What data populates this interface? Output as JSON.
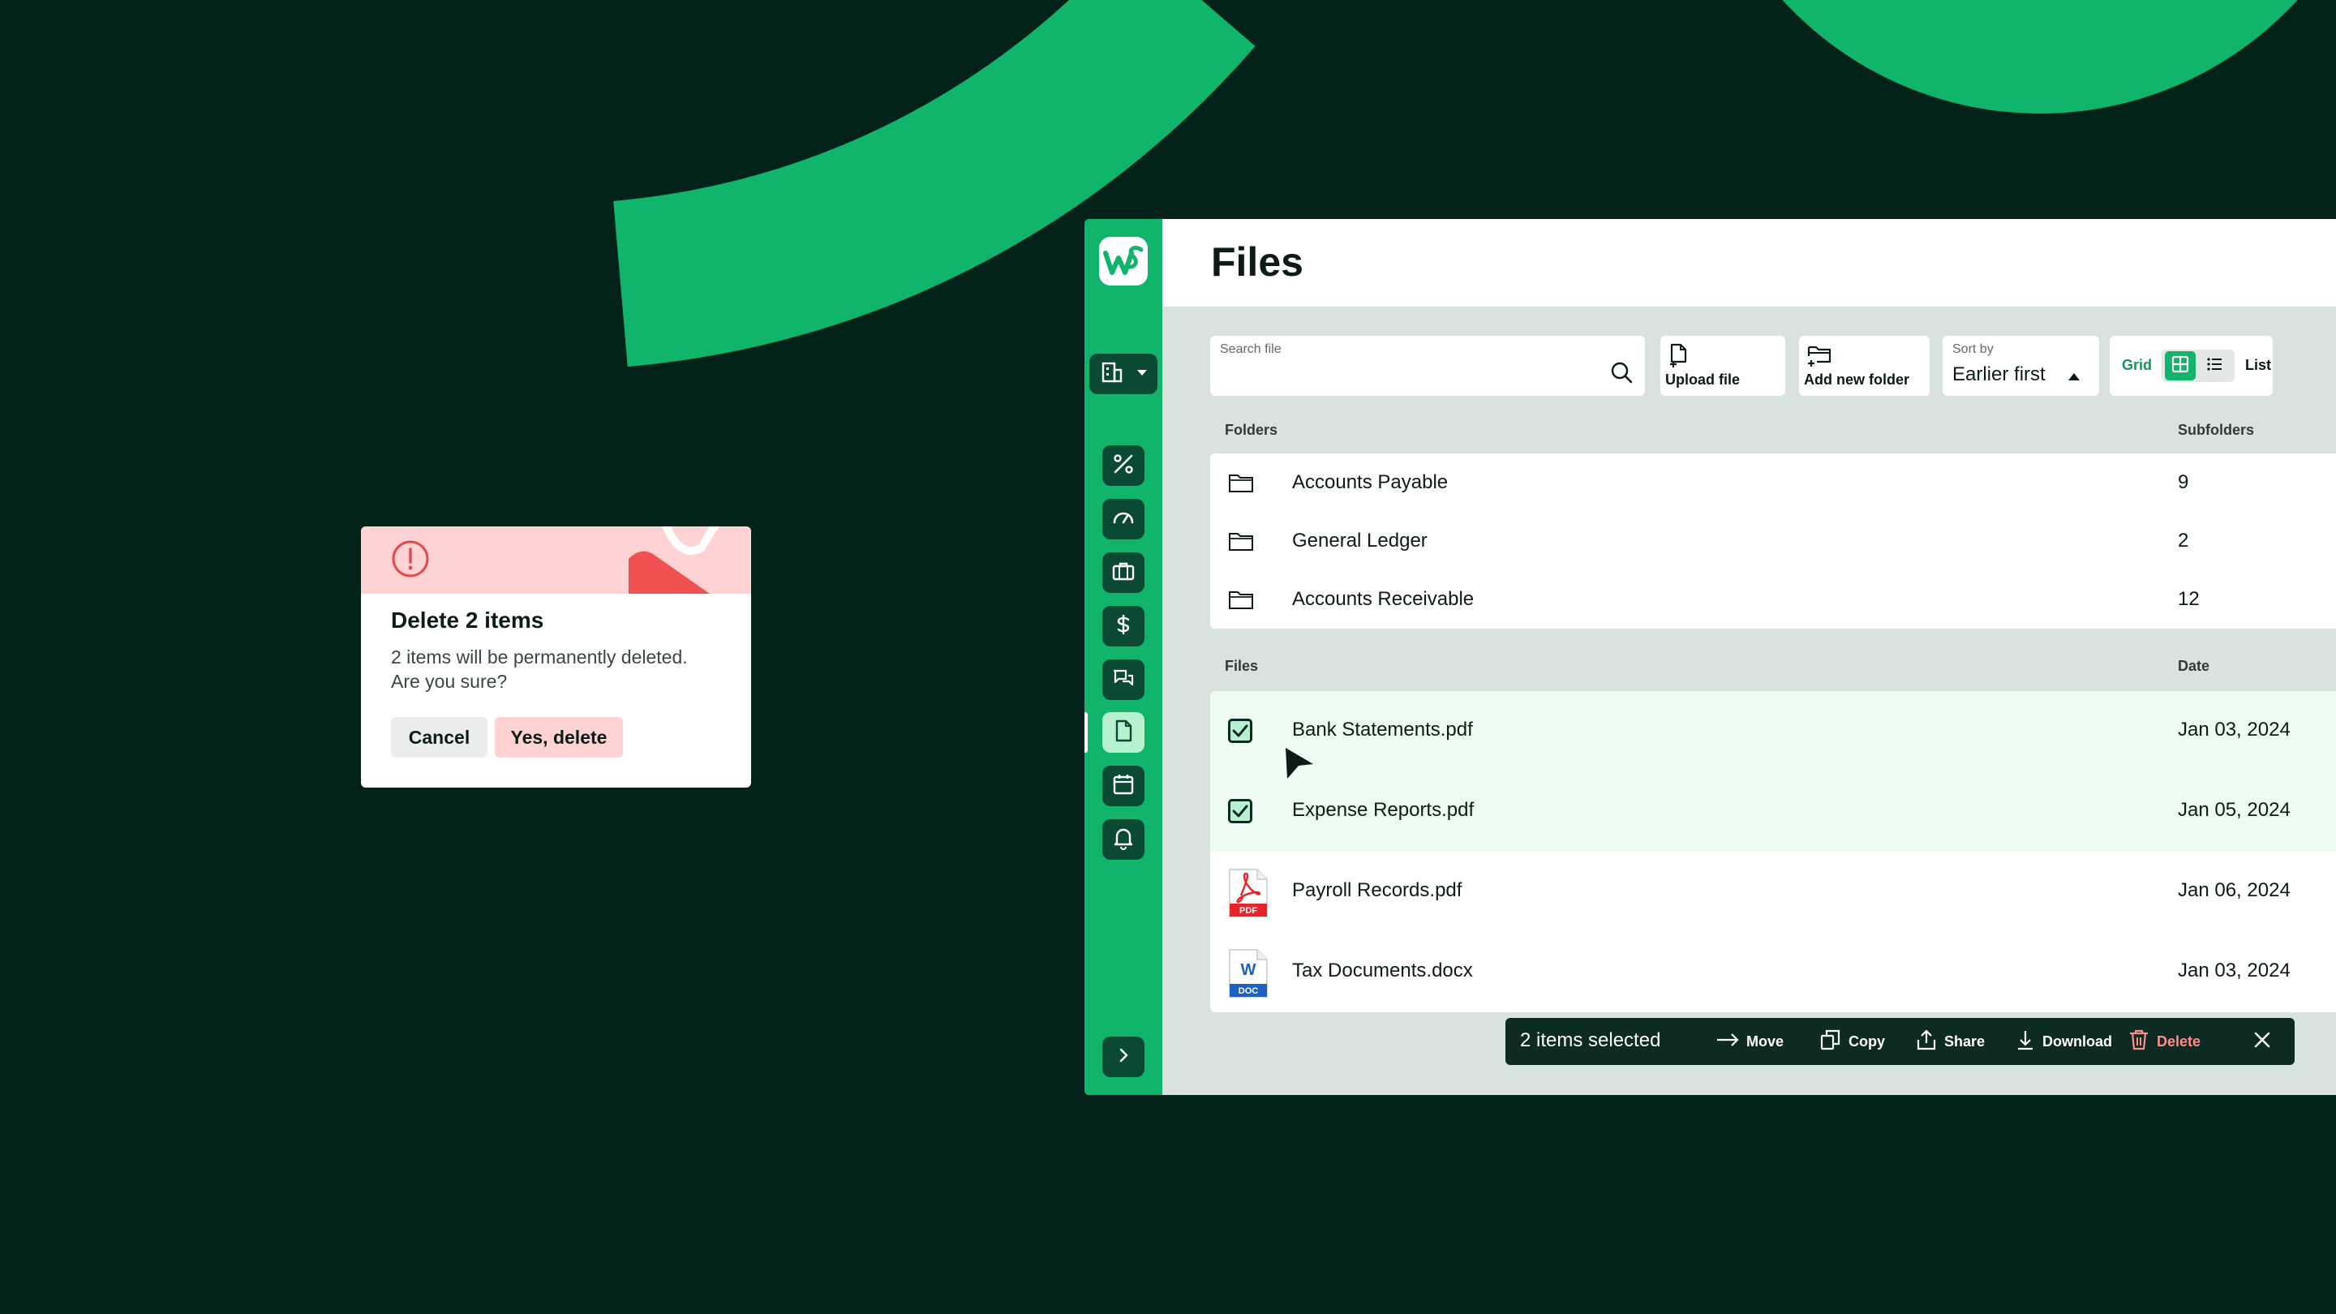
{
  "colors": {
    "brand_green": "#10b46a",
    "background": "#03221a",
    "danger": "#e5484d"
  },
  "sidebar": {
    "logo": "ws-logo",
    "org_switch_icon": "building-icon",
    "nav": [
      "percent-icon",
      "gauge-icon",
      "briefcase-icon",
      "dollar-icon",
      "chat-icon",
      "file-icon",
      "calendar-icon",
      "bell-icon"
    ],
    "active": "file-icon",
    "expand_icon": "chevron-right-icon"
  },
  "header": {
    "title": "Files"
  },
  "toolbar": {
    "search_label": "Search file",
    "upload_label": "Upload file",
    "add_folder_label": "Add new folder",
    "sort_label": "Sort by",
    "sort_value": "Earlier first",
    "view_grid_label": "Grid",
    "view_list_label": "List",
    "active_view": "grid"
  },
  "folders": {
    "header": "Folders",
    "count_header": "Subfolders",
    "items": [
      {
        "name": "Accounts Payable",
        "subfolders": "9"
      },
      {
        "name": "General Ledger",
        "subfolders": "2"
      },
      {
        "name": "Accounts Receivable",
        "subfolders": "12"
      }
    ]
  },
  "files": {
    "header": "Files",
    "date_header": "Date",
    "items": [
      {
        "name": "Bank Statements.pdf",
        "date": "Jan 03, 2024",
        "selected": true
      },
      {
        "name": "Expense Reports.pdf",
        "date": "Jan 05, 2024",
        "selected": true
      },
      {
        "name": "Payroll Records.pdf",
        "date": "Jan 06, 2024",
        "selected": false,
        "badge": "PDF"
      },
      {
        "name": "Tax Documents.docx",
        "date": "Jan 03, 2024",
        "selected": false,
        "badge": "DOC",
        "glyph": "W"
      }
    ]
  },
  "action_bar": {
    "count": "2 items selected",
    "move": "Move",
    "copy": "Copy",
    "share": "Share",
    "download": "Download",
    "delete": "Delete"
  },
  "dialog": {
    "title": "Delete 2 items",
    "message_line1": "2 items will be permanently deleted.",
    "message_line2": "Are you sure?",
    "cancel": "Cancel",
    "confirm": "Yes, delete"
  }
}
